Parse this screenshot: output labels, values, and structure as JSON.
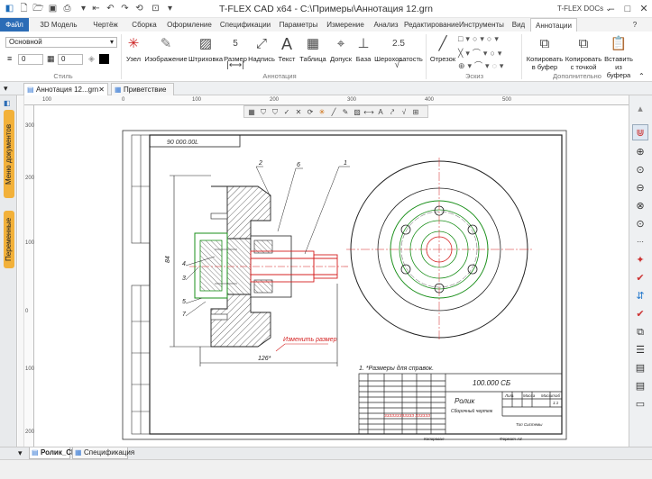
{
  "window": {
    "title": "T-FLEX CAD x64 - C:\\Примеры\\Аннотация 12.grn",
    "docs_button": "T-FLEX DOCs",
    "docs_menu_chevron": "⌄"
  },
  "menu": {
    "tabs": [
      "Файл",
      "3D Модель",
      "Чертёж",
      "Сборка",
      "Оформление",
      "Спецификации",
      "Параметры",
      "Измерение",
      "Анализ",
      "Редактирование",
      "Инструменты",
      "Вид",
      "Аннотации"
    ],
    "active": "Аннотации"
  },
  "ribbon": {
    "style_group": {
      "layer_value": "Основной",
      "field1_value": "0",
      "field2_value": "0",
      "label": "Стиль"
    },
    "annotation_buttons": [
      "Узел",
      "Изображение",
      "Штриховка",
      "Размер",
      "Надпись",
      "Текст",
      "Таблица",
      "Допуск",
      "База",
      "Шероховатость"
    ],
    "annotation_label": "Аннотация",
    "sketch_button": "Отрезок",
    "sketch_label": "Эскиз",
    "extra_buttons": [
      "Копировать в буфер",
      "Копировать с точкой",
      "Вставить из буфера"
    ],
    "extra_label": "Дополнительно",
    "size_icon_text": "5",
    "roughness_icon_text": "2.5"
  },
  "doc_tabs": [
    {
      "label": "Аннотация 12...grn",
      "active": true
    },
    {
      "label": "Приветствие",
      "active": false
    }
  ],
  "left_panel": {
    "tabs": [
      "Меню документов",
      "Переменные"
    ]
  },
  "ruler": {
    "h": [
      "100",
      "0",
      "100",
      "200",
      "300",
      "400",
      "500"
    ],
    "v": [
      "300",
      "200",
      "100",
      "0",
      "100",
      "200"
    ]
  },
  "drawing": {
    "designation_top": "90 000.00L",
    "dim_vertical": "84",
    "dim_horizontal": "126*",
    "callouts": [
      "1",
      "2",
      "3",
      "4",
      "5",
      "6",
      "7"
    ],
    "note_size": "Изменить размер",
    "tech_req": "1. *Размеры для справок.",
    "title_block": {
      "designation": "100.000 СБ",
      "part_name": "Ролик",
      "doc_type": "Сборочный чертеж",
      "stage_header": "Лит.",
      "mass_header": "Масса",
      "scale_header": "Масштаб",
      "scale_value": "1:1",
      "org": "Топ Системы",
      "copied": "Копировал",
      "format": "Формат А3",
      "red_note": "ЗЗЗЗЗЗЗЗЗЗЗЗ ЗЗЗЗЗЗ"
    }
  },
  "bottom_tabs": [
    {
      "label": "Ролик_СБ",
      "active": true
    },
    {
      "label": "Спецификация",
      "active": false
    }
  ],
  "colors": {
    "file_tab": "#2b6cb6",
    "panel_tab": "#f2b13a",
    "drawing_red": "#d42020",
    "drawing_green": "#1a8f1a",
    "hatch": "#333333"
  }
}
